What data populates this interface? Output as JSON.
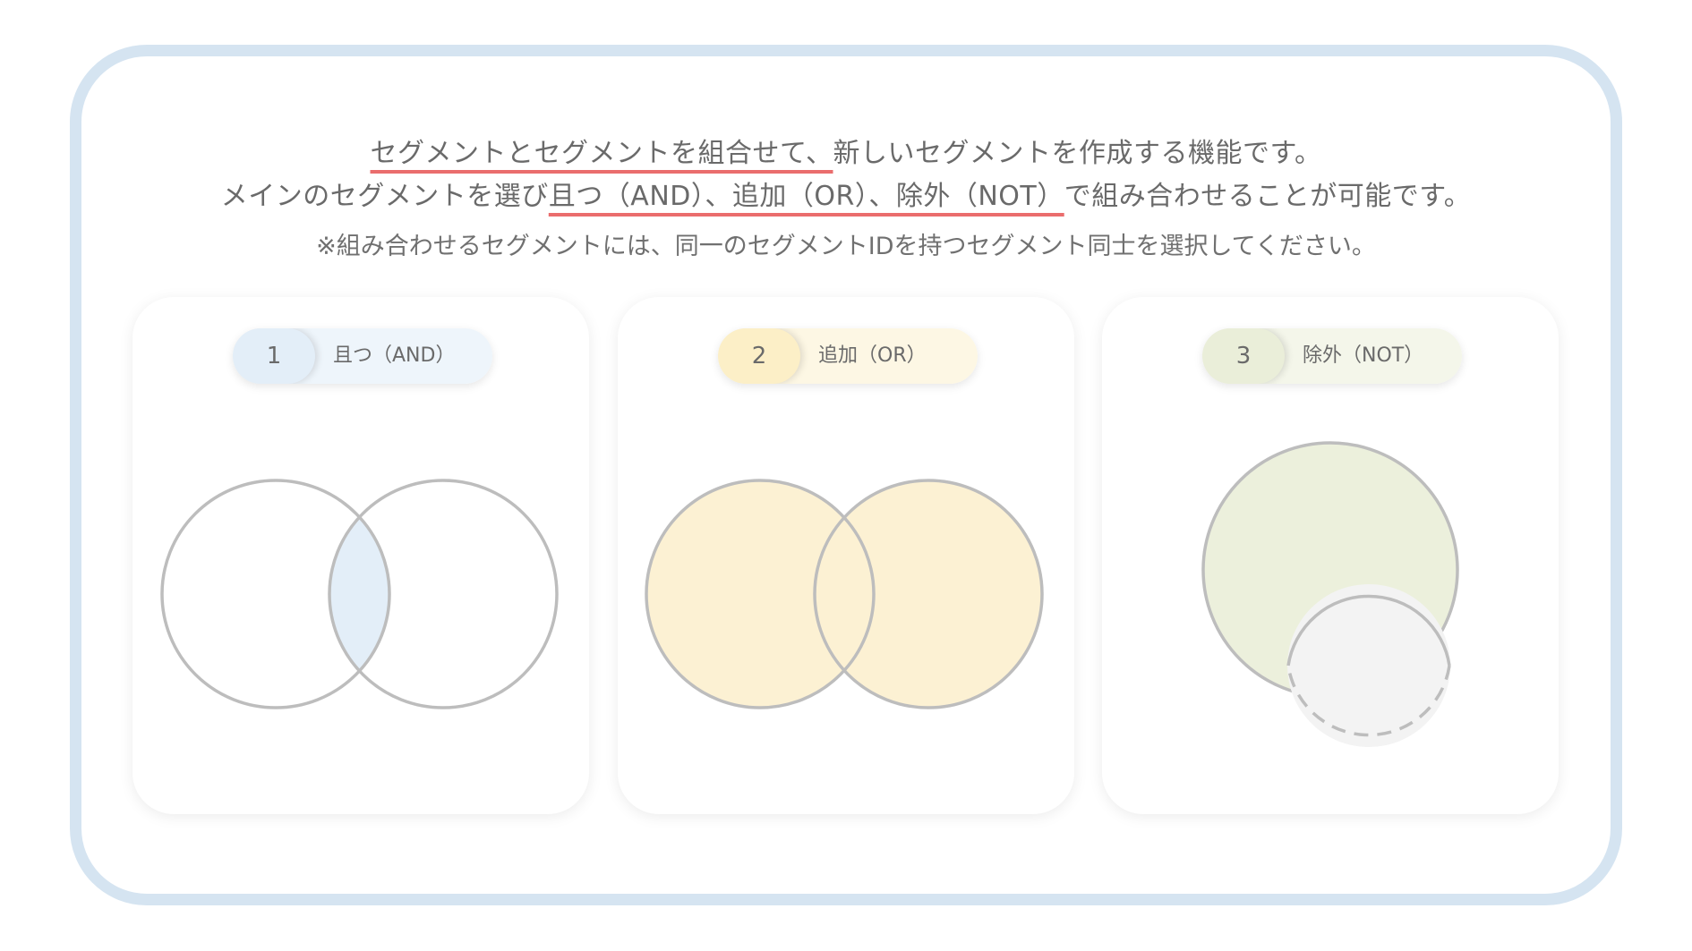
{
  "intro": {
    "line1": {
      "segments": [
        {
          "text": "セグメントとセグメントを組合せて、",
          "underline": true
        },
        {
          "text": "新しいセグメントを作成する機能です。",
          "underline": false
        }
      ]
    },
    "line2": {
      "segments": [
        {
          "text": "メインのセグメントを選び",
          "underline": false
        },
        {
          "text": "且つ（AND）、追加（OR）、除外（NOT）",
          "underline": true
        },
        {
          "text": "で組み合わせることが可能です。",
          "underline": false
        }
      ]
    },
    "note": "※組み合わせるセグメントには、同一のセグメントIDを持つセグメント同士を選択してください。"
  },
  "cards": [
    {
      "number": "1",
      "label": "且つ（AND）",
      "pill_number_color": "#e3eef8",
      "pill_label_color": "#eef5fb"
    },
    {
      "number": "2",
      "label": "追加（OR）",
      "pill_number_color": "#fcefc7",
      "pill_label_color": "#fdf7e4"
    },
    {
      "number": "3",
      "label": "除外（NOT）",
      "pill_number_color": "#eaeed9",
      "pill_label_color": "#f4f6ea"
    }
  ],
  "colors": {
    "frame_border": "#d5e4f1",
    "underline": "#ea6d6d",
    "and_fill": "#e3eef8",
    "or_fill": "#fcf1d3",
    "not_main_fill": "#ecf0dc",
    "not_excluded_fill": "#f3f3f3",
    "circle_stroke": "#bdbdbd"
  }
}
